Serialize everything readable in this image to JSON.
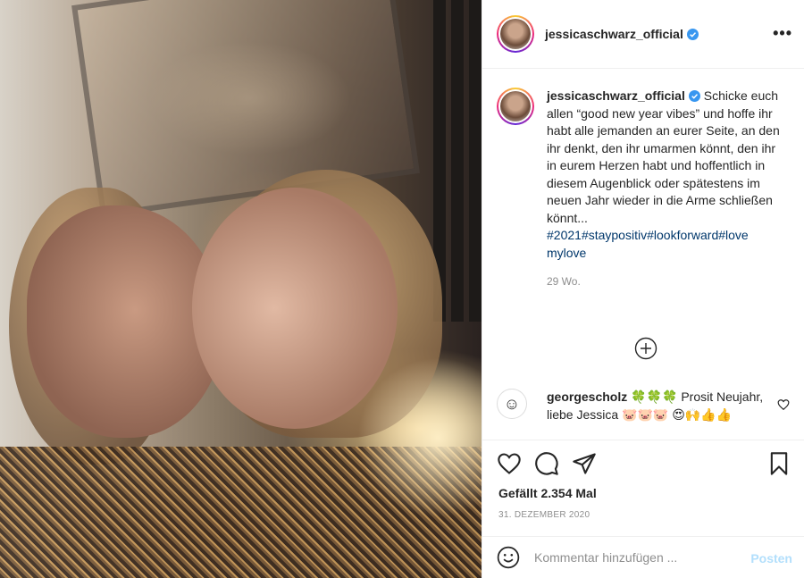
{
  "post": {
    "username": "jessicaschwarz_official",
    "verified": true,
    "more_icon": "more-horizontal-icon",
    "caption_text": "Schicke euch allen “good new year vibes” und hoffe ihr habt alle jemanden an eurer Seite, an den ihr denkt, den ihr umarmen könnt, den ihr in eurem Herzen habt und hoffentlich in diesem Augenblick oder spätestens im neuen Jahr wieder in die Arme schließen könnt...",
    "hashtags": [
      "#2021",
      "#staypositiv",
      "#lookforward",
      "#love",
      "mylove"
    ],
    "age": "29 Wo.",
    "load_more_icon": "plus-circle-icon"
  },
  "comment": {
    "username": "georgescholz",
    "text": "Prosit Neujahr, liebe Jessica",
    "emoji_line1": "🍀🍀🍀",
    "emoji_line2": "🐷🐷🐷",
    "emoji_line3": "😍🙌👍👍"
  },
  "actions": {
    "icons": [
      "heart-icon",
      "comment-icon",
      "share-icon",
      "bookmark-icon"
    ],
    "likes": "Gefällt 2.354 Mal",
    "date": "31. DEZEMBER 2020"
  },
  "add_comment": {
    "placeholder": "Kommentar hinzufügen ...",
    "post_label": "Posten"
  },
  "colors": {
    "link": "#00376b",
    "verified_blue": "#3897f0",
    "post_button_disabled": "#b2dffc",
    "secondary_text": "#8e8e8e"
  }
}
